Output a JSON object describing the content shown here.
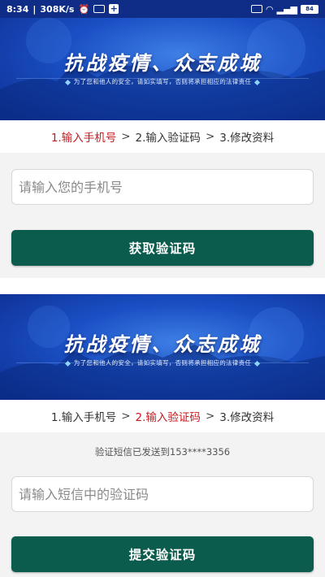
{
  "status_bar": {
    "time": "8:34",
    "speed": "308K/s",
    "battery": "84"
  },
  "banner": {
    "title": "抗战疫情、众志成城",
    "subtitle": "为了您和他人的安全，请如实填写，否则将承担相应的法律责任"
  },
  "screen1": {
    "steps": [
      "1.输入手机号",
      "2.输入验证码",
      "3.修改资料"
    ],
    "active_step": 0,
    "phone_input": {
      "placeholder": "请输入您的手机号",
      "value": ""
    },
    "button_label": "获取验证码"
  },
  "screen2": {
    "steps": [
      "1.输入手机号",
      "2.输入验证码",
      "3.修改资料"
    ],
    "active_step": 1,
    "notice": "验证短信已发送到153****3356",
    "code_input": {
      "placeholder": "请输入短信中的验证码",
      "value": ""
    },
    "button_label": "提交验证码"
  },
  "colors": {
    "status_bar": "#0f2d87",
    "banner_blue": "#1a4fc4",
    "active_step": "#c8171d",
    "button": "#0c5c4d"
  },
  "separator": ">"
}
